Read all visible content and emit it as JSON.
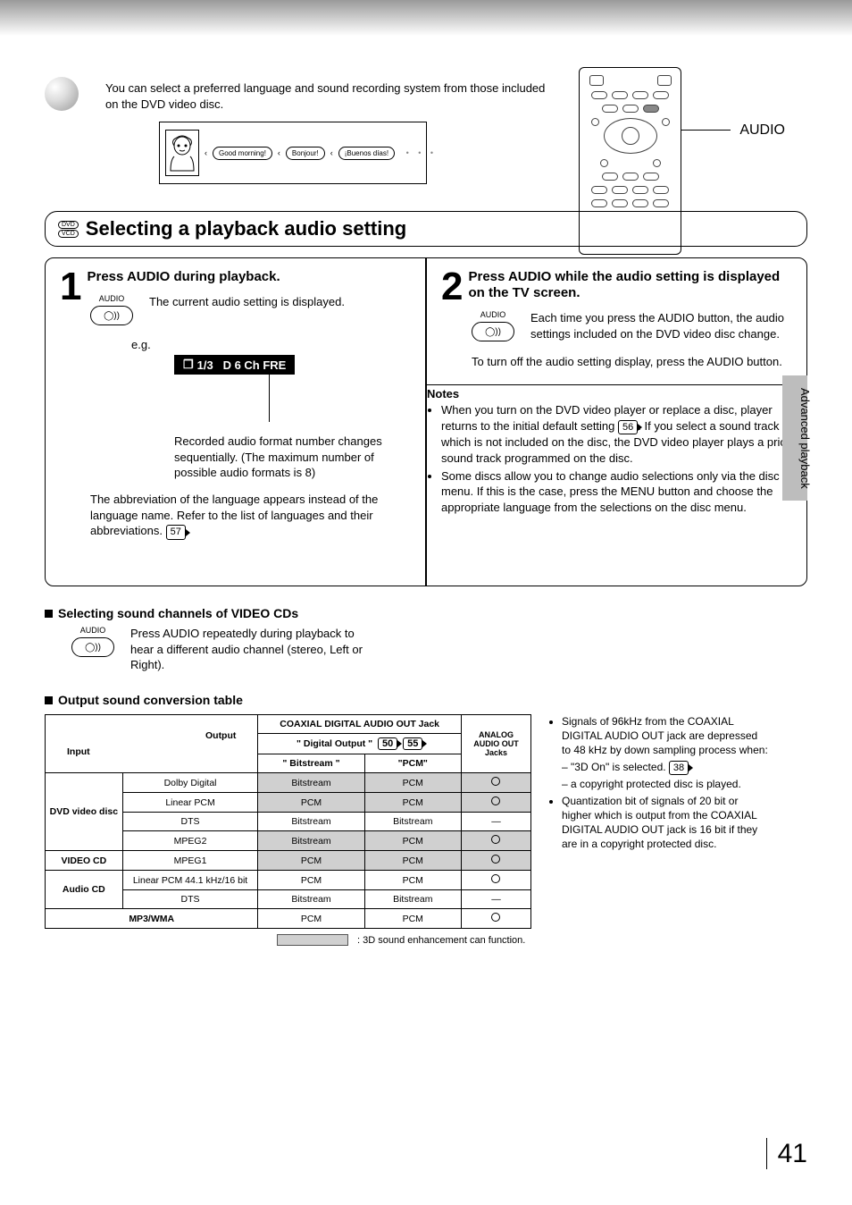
{
  "intro": "You can select a preferred language and sound recording system from those included on the DVD video disc.",
  "bubbles": [
    "Good morning!",
    "Bonjour!",
    "¡Buenos días!"
  ],
  "remote_label": "AUDIO",
  "section_heading": "Selecting a playback audio setting",
  "step1": {
    "num": "1",
    "title": "Press AUDIO during playback.",
    "icon_label": "AUDIO",
    "body": "The current audio setting is displayed.",
    "eg": "e.g.",
    "osd": "1/3   D 6 Ch FRE",
    "desc": "Recorded audio format number changes sequentially. (The maximum number of possible audio formats is 8)",
    "abbrev": "The abbreviation of the language appears instead of the language name. Refer to the list of languages and their abbreviations.",
    "abbrev_ref": "57"
  },
  "step2": {
    "num": "2",
    "title": "Press AUDIO while the audio setting is displayed on the TV screen.",
    "icon_label": "AUDIO",
    "body1": "Each time you press the AUDIO button, the audio settings included on the DVD video disc change.",
    "body2": "To turn off the audio setting display, press the AUDIO button."
  },
  "notes_title": "Notes",
  "notes": [
    {
      "t": "When you turn on the DVD video player or replace a disc, player returns to the initial default setting",
      "ref": "56",
      "t2": ". If you select a sound track which is not included on the disc, the DVD video player plays a prior sound track programmed on the disc."
    },
    {
      "t": "Some discs allow you to change audio selections only via the disc menu.  If this is the case, press the MENU button and choose the appropriate language from the selections on the disc menu."
    }
  ],
  "vcd_heading": "Selecting sound channels of VIDEO CDs",
  "vcd_text": "Press AUDIO repeatedly during playback to hear a different audio channel (stereo, Left or Right).",
  "conv_heading": "Output sound conversion table",
  "table": {
    "super_out": "Output",
    "super_in": "Input",
    "coax_header": "COAXIAL DIGITAL AUDIO OUT Jack",
    "digout": "\" Digital Output \"",
    "digout_refs": [
      "50",
      "55"
    ],
    "bitstream_hdr": "\" Bitstream \"",
    "pcm_hdr": "\"PCM\"",
    "analog_hdr": "ANALOG AUDIO OUT Jacks",
    "rows": [
      {
        "group": "DVD video disc",
        "fmt": "Dolby Digital",
        "c1": {
          "v": "Bitstream",
          "s": true
        },
        "c2": {
          "v": "PCM",
          "s": true
        },
        "c3": "circle"
      },
      {
        "group": "",
        "fmt": "Linear PCM",
        "c1": {
          "v": "PCM",
          "s": true
        },
        "c2": {
          "v": "PCM",
          "s": true
        },
        "c3": "circle"
      },
      {
        "group": "",
        "fmt": "DTS",
        "c1": {
          "v": "Bitstream",
          "s": false
        },
        "c2": {
          "v": "Bitstream",
          "s": false
        },
        "c3": "dash"
      },
      {
        "group": "",
        "fmt": "MPEG2",
        "c1": {
          "v": "Bitstream",
          "s": true
        },
        "c2": {
          "v": "PCM",
          "s": true
        },
        "c3": "circle"
      },
      {
        "group": "VIDEO CD",
        "fmt": "MPEG1",
        "c1": {
          "v": "PCM",
          "s": true
        },
        "c2": {
          "v": "PCM",
          "s": true
        },
        "c3": "circle"
      },
      {
        "group": "Audio CD",
        "fmt": "Linear PCM 44.1 kHz/16 bit",
        "c1": {
          "v": "PCM",
          "s": false
        },
        "c2": {
          "v": "PCM",
          "s": false
        },
        "c3": "open"
      },
      {
        "group": "",
        "fmt": "DTS",
        "c1": {
          "v": "Bitstream",
          "s": false
        },
        "c2": {
          "v": "Bitstream",
          "s": false
        },
        "c3": "dash"
      },
      {
        "group": "MP3/WMA",
        "fmt": "",
        "c1": {
          "v": "PCM",
          "s": false
        },
        "c2": {
          "v": "PCM",
          "s": false
        },
        "c3": "open"
      }
    ]
  },
  "legend": ": 3D sound enhancement can function.",
  "side_notes": [
    {
      "t": "Signals of 96kHz from the COAXIAL DIGITAL AUDIO OUT jack are depressed to 48 kHz by down sampling process when:"
    },
    {
      "dash": true,
      "t": "– \"3D On\" is selected.",
      "ref": "38"
    },
    {
      "dash": true,
      "t": "– a copyright protected disc is played."
    },
    {
      "t": "Quantization bit of signals of 20 bit or higher which is output from the COAXIAL DIGITAL AUDIO OUT jack is 16 bit if they are in a copyright protected disc."
    }
  ],
  "side_tab": "Advanced playback",
  "page_number": "41"
}
